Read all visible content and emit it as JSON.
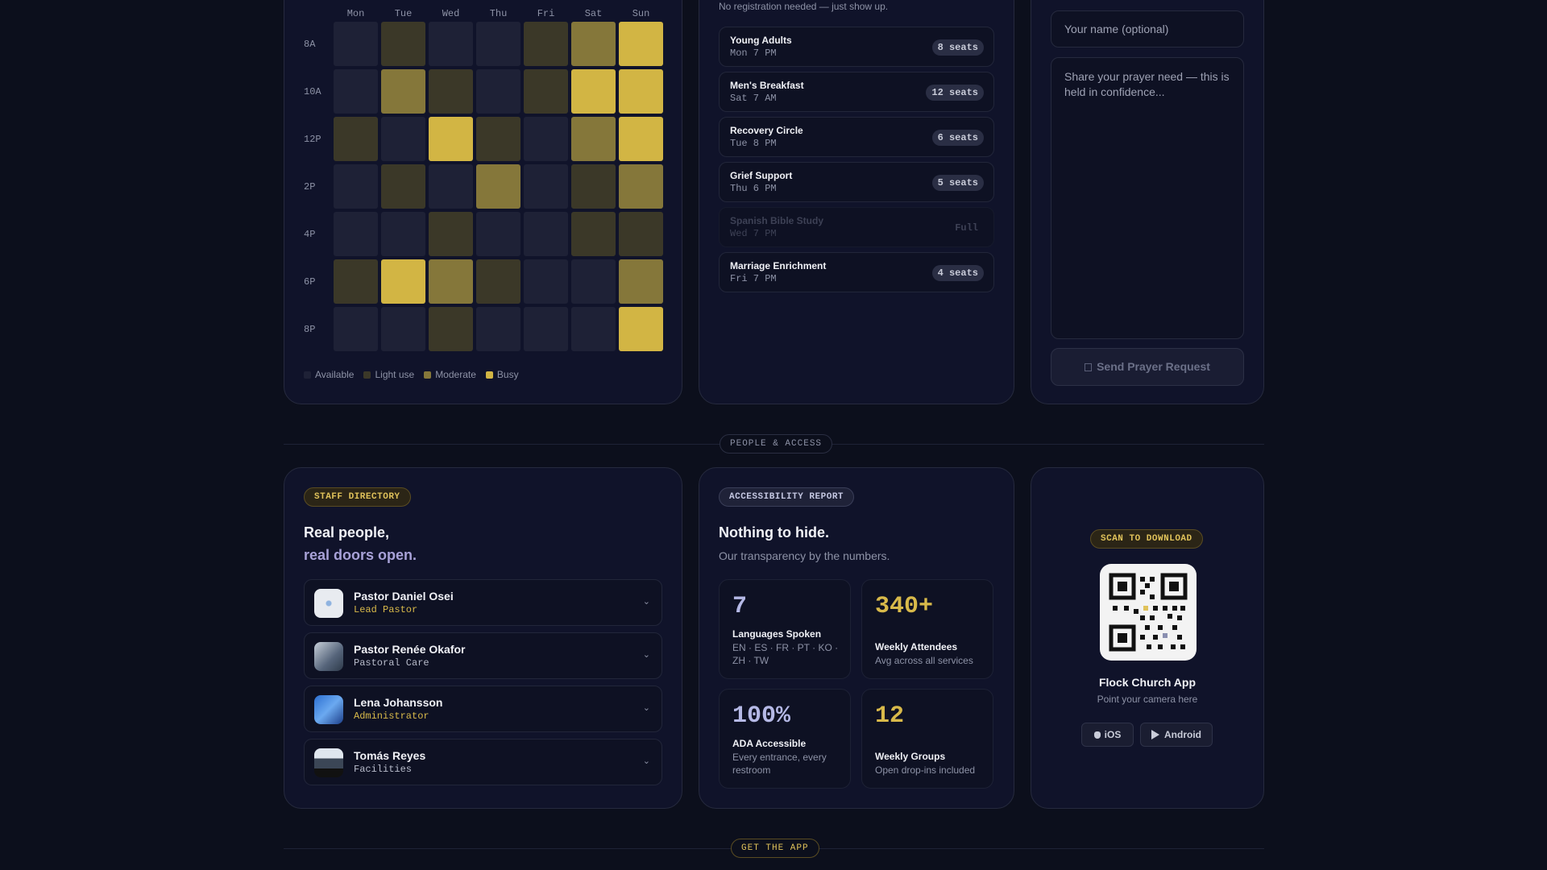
{
  "heatmap": {
    "days": [
      "Mon",
      "Tue",
      "Wed",
      "Thu",
      "Fri",
      "Sat",
      "Sun"
    ],
    "hours": [
      "8A",
      "10A",
      "12P",
      "2P",
      "4P",
      "6P",
      "8P"
    ],
    "levels": [
      [
        0,
        1,
        0,
        0,
        1,
        2,
        3
      ],
      [
        0,
        2,
        1,
        0,
        1,
        3,
        3
      ],
      [
        1,
        0,
        3,
        1,
        0,
        2,
        3
      ],
      [
        0,
        1,
        0,
        2,
        0,
        1,
        2
      ],
      [
        0,
        0,
        1,
        0,
        0,
        1,
        1
      ],
      [
        1,
        3,
        2,
        1,
        0,
        0,
        2
      ],
      [
        0,
        0,
        1,
        0,
        0,
        0,
        3
      ]
    ],
    "legend": [
      "Available",
      "Light use",
      "Moderate",
      "Busy"
    ],
    "colors": [
      "#1e2136",
      "#3b3828",
      "#85773a",
      "#d2b544"
    ]
  },
  "groups": {
    "note": "No registration needed — just show up.",
    "items": [
      {
        "name": "Young Adults",
        "time": "Mon 7 PM",
        "seats": "8 seats",
        "full": false
      },
      {
        "name": "Men's Breakfast",
        "time": "Sat 7 AM",
        "seats": "12 seats",
        "full": false
      },
      {
        "name": "Recovery Circle",
        "time": "Tue 8 PM",
        "seats": "6 seats",
        "full": false
      },
      {
        "name": "Grief Support",
        "time": "Thu 6 PM",
        "seats": "5 seats",
        "full": false
      },
      {
        "name": "Spanish Bible Study",
        "time": "Wed 7 PM",
        "seats": "Full",
        "full": true
      },
      {
        "name": "Marriage Enrichment",
        "time": "Fri 7 PM",
        "seats": "4 seats",
        "full": false
      }
    ]
  },
  "prayer": {
    "name_placeholder": "Your name (optional)",
    "need_placeholder": "Share your prayer need — this is held in confidence...",
    "submit_label": "Send Prayer Request"
  },
  "dividers": {
    "people": "PEOPLE & ACCESS",
    "app": "GET THE APP"
  },
  "staff": {
    "badge": "STAFF DIRECTORY",
    "headline_1": "Real people,",
    "headline_2": "real doors open.",
    "members": [
      {
        "name": "Pastor Daniel Osei",
        "role": "Lead Pastor",
        "role_color": "#d8b94a"
      },
      {
        "name": "Pastor Renée Okafor",
        "role": "Pastoral Care",
        "role_color": "#b8bccb"
      },
      {
        "name": "Lena Johansson",
        "role": "Administrator",
        "role_color": "#d8b94a"
      },
      {
        "name": "Tomás Reyes",
        "role": "Facilities",
        "role_color": "#b8bccb"
      }
    ]
  },
  "accessibility": {
    "badge": "ACCESSIBILITY REPORT",
    "headline": "Nothing to hide.",
    "subtitle": "Our transparency by the numbers.",
    "stats": [
      {
        "value": "7",
        "label": "Languages Spoken",
        "sub": "EN · ES · FR · PT · KO · ZH · TW",
        "color": "#b5b9e6"
      },
      {
        "value": "340+",
        "label": "Weekly Attendees",
        "sub": "Avg across all services",
        "color": "#d8b94a"
      },
      {
        "value": "100%",
        "label": "ADA Accessible",
        "sub": "Every entrance, every restroom",
        "color": "#b5b9e6"
      },
      {
        "value": "12",
        "label": "Weekly Groups",
        "sub": "Open drop-ins included",
        "color": "#d8b94a"
      }
    ]
  },
  "app": {
    "badge": "SCAN TO DOWNLOAD",
    "title": "Flock Church App",
    "subtitle": "Point your camera here",
    "ios_label": "iOS",
    "android_label": "Android"
  }
}
